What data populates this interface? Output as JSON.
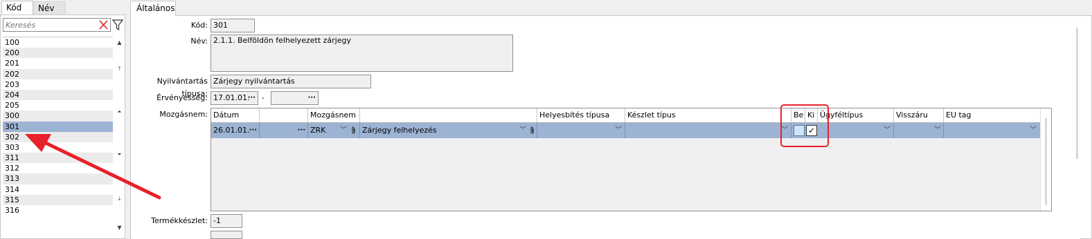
{
  "left": {
    "tabs": [
      "Kód",
      "Név"
    ],
    "search_placeholder": "Keresés",
    "items": [
      "100",
      "200",
      "201",
      "202",
      "203",
      "204",
      "205",
      "300",
      "301",
      "302",
      "303",
      "311",
      "312",
      "313",
      "314",
      "315",
      "316"
    ],
    "selected": "301"
  },
  "right": {
    "tab": "Általános",
    "labels": {
      "kod": "Kód:",
      "nev": "Név:",
      "nyilv": "Nyilvántartás típusa:",
      "erv": "Érvényesség:",
      "mozg": "Mozgásnem:",
      "termek": "Termékkészlet:"
    },
    "values": {
      "kod": "301",
      "nev": "2.1.1. Belföldön felhelyezett zárjegy",
      "nyilv": "Zárjegy nyilvántartás",
      "erv_from": "17.01.01.",
      "erv_sep": "-",
      "erv_to": "",
      "termek": "-1"
    },
    "grid": {
      "headers": [
        "Dátum",
        "",
        "Mozgásnem",
        "",
        "Helyesbítés típusa",
        "Készlet típus",
        "Be",
        "Ki",
        "Ügyféltípus",
        "Visszáru",
        "EU tag"
      ],
      "row": {
        "datum": "26.01.01.",
        "mozg_kod": "ZRK",
        "mozg_nev": "Zárjegy felhelyezés",
        "be": false,
        "ki": true,
        "ki_mark": "✓"
      }
    }
  },
  "colors": {
    "selection": "#9cb3d3",
    "annotation": "#e8202a"
  }
}
